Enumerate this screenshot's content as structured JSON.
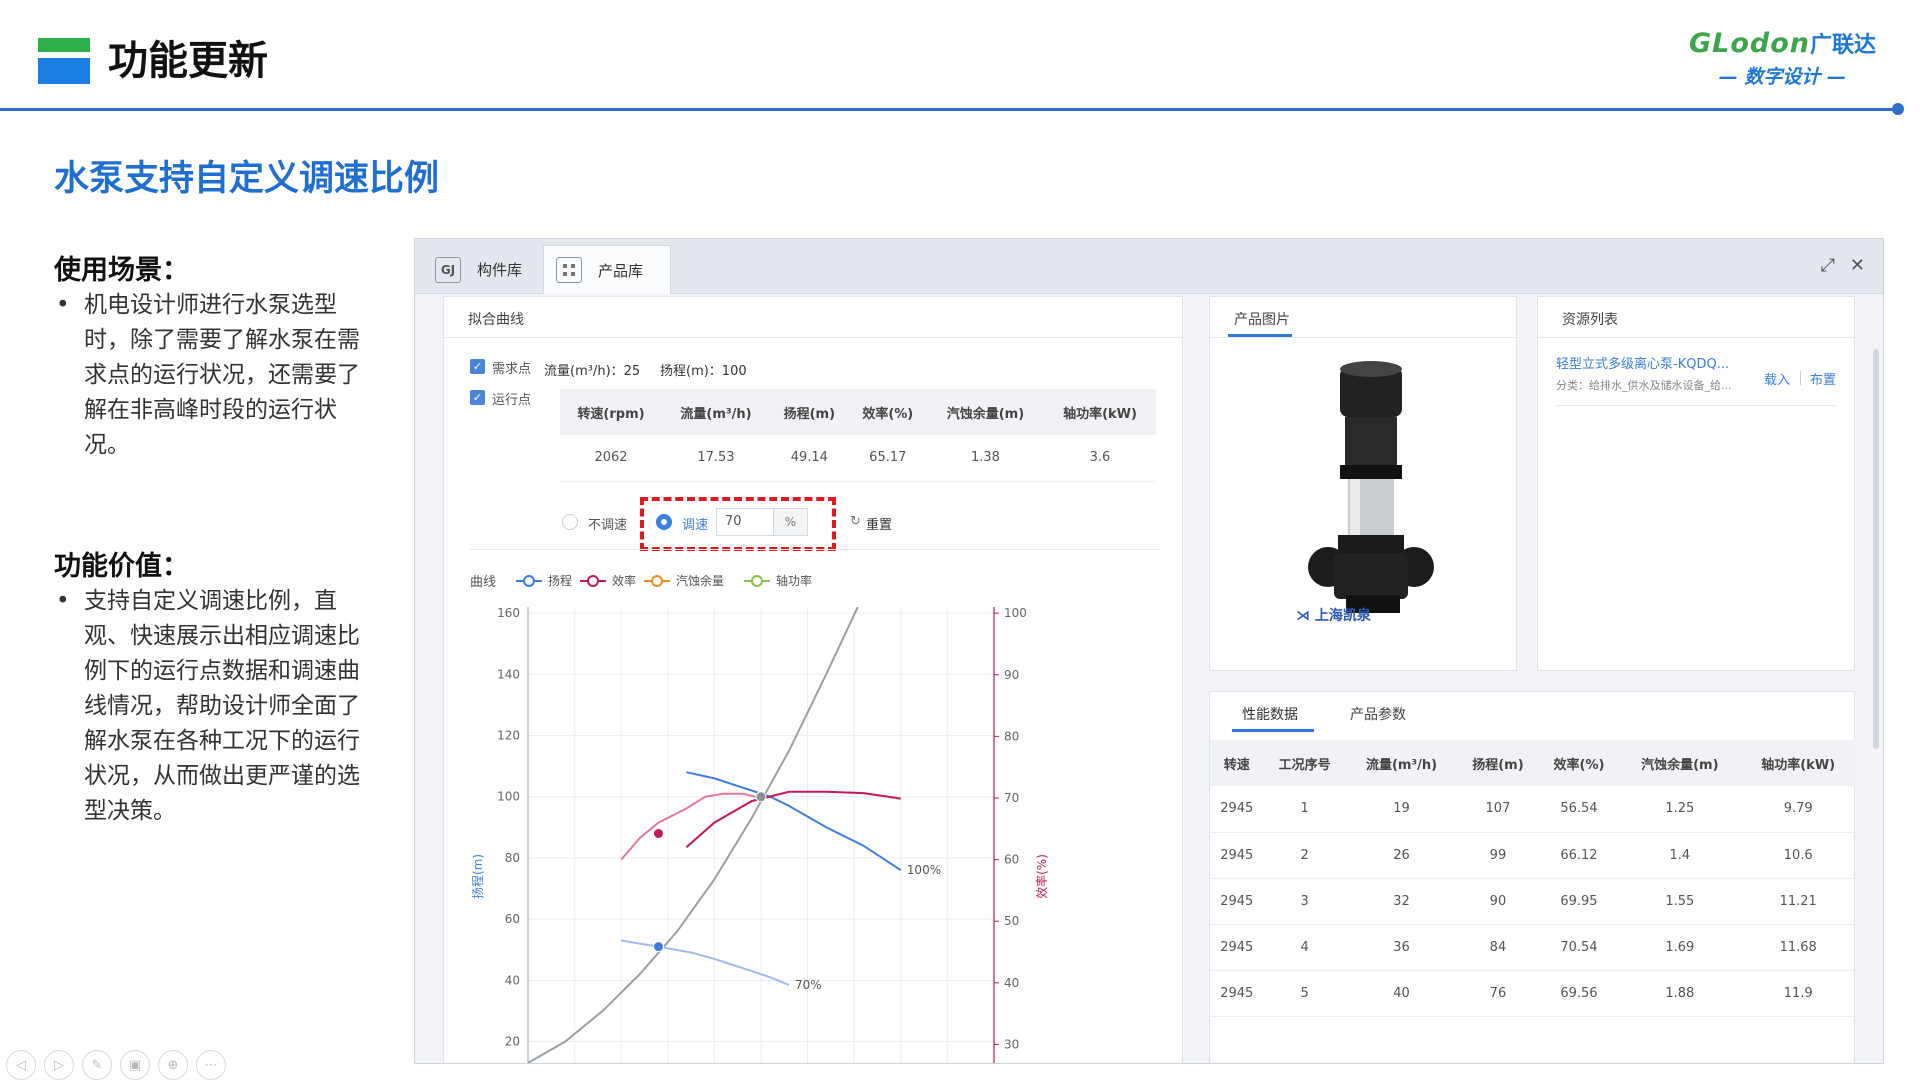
{
  "slide": {
    "title": "功能更新",
    "brand_name": "GLodon",
    "brand_cn": "广联达",
    "brand_sub": "— 数字设计 —",
    "subtitle": "水泵支持自定义调速比例",
    "scenario_heading": "使用场景：",
    "scenario_text": "机电设计师进行水泵选型时，除了需要了解水泵在需求点的运行状况，还需要了解在非高峰时段的运行状况。",
    "value_heading": "功能价值：",
    "value_text": "支持自定义调速比例，直观、快速展示出相应调速比例下的运行点数据和调速曲线情况，帮助设计师全面了解水泵在各种工况下的运行状况，从而做出更严谨的选型决策。"
  },
  "app": {
    "tabs": [
      {
        "label": "构件库",
        "icon": "GJ"
      },
      {
        "label": "产品库",
        "icon": "grid"
      }
    ],
    "curve_panel": {
      "title": "拟合曲线",
      "demand_point": {
        "checked": true,
        "label": "需求点",
        "flow_label": "流量(m³/h)：25",
        "head_label": "扬程(m)：100"
      },
      "operating_point": {
        "checked": true,
        "label": "运行点",
        "headers": [
          "转速(rpm)",
          "流量(m³/h)",
          "扬程(m)",
          "效率(%)",
          "汽蚀余量(m)",
          "轴功率(kW)"
        ],
        "values": [
          "2062",
          "17.53",
          "49.14",
          "65.17",
          "1.38",
          "3.6"
        ]
      },
      "speed": {
        "no_speed_label": "不调速",
        "speed_label": "调速",
        "speed_selected": true,
        "speed_value": "70",
        "unit": "%",
        "reset_label": "重置"
      },
      "legend_title": "曲线",
      "legend": [
        {
          "name": "扬程",
          "color": "#3f7ee0"
        },
        {
          "name": "效率",
          "color": "#c2185b"
        },
        {
          "name": "汽蚀余量",
          "color": "#f08c1c"
        },
        {
          "name": "轴功率",
          "color": "#8bc34a"
        }
      ]
    },
    "image_panel": {
      "title": "产品图片",
      "maker_logo": "上海凯泉"
    },
    "resource_panel": {
      "title": "资源列表",
      "item_name": "轻型立式多级离心泵-KQDQ...",
      "item_category": "分类：给排水_供水及储水设备_给...",
      "load_label": "载入",
      "place_label": "布置"
    },
    "perf_panel": {
      "tabs": [
        "性能数据",
        "产品参数"
      ],
      "headers": [
        "转速",
        "工况序号",
        "流量(m³/h)",
        "扬程(m)",
        "效率(%)",
        "汽蚀余量(m)",
        "轴功率(kW)"
      ],
      "rows": [
        [
          "2945",
          "1",
          "19",
          "107",
          "56.54",
          "1.25",
          "9.79"
        ],
        [
          "2945",
          "2",
          "26",
          "99",
          "66.12",
          "1.4",
          "10.6"
        ],
        [
          "2945",
          "3",
          "32",
          "90",
          "69.95",
          "1.55",
          "11.21"
        ],
        [
          "2945",
          "4",
          "36",
          "84",
          "70.54",
          "1.69",
          "11.68"
        ],
        [
          "2945",
          "5",
          "40",
          "76",
          "69.56",
          "1.88",
          "11.9"
        ]
      ]
    }
  },
  "chart_data": {
    "type": "line",
    "ylabel": "扬程(m)",
    "y2label": "效率(%)",
    "ylim": [
      12,
      162
    ],
    "y2lim": [
      26.5,
      101
    ],
    "yticks": [
      20,
      40,
      60,
      80,
      100,
      120,
      140,
      160
    ],
    "y2ticks": [
      30,
      40,
      50,
      60,
      70,
      80,
      90,
      100
    ],
    "x_range": [
      0,
      50
    ],
    "grid": true,
    "series": [
      {
        "name": "系统曲线",
        "color": "#9aa0a6",
        "axis": "left",
        "x": [
          0,
          4,
          8,
          12,
          16,
          20,
          24,
          28,
          32,
          36
        ],
        "y": [
          13,
          20,
          30,
          42,
          56,
          73,
          93,
          115,
          140,
          166
        ]
      },
      {
        "name": "扬程",
        "color": "#3f7ee0",
        "axis": "left",
        "label": "100%",
        "x": [
          17,
          20,
          24,
          26,
          28,
          32,
          36,
          40
        ],
        "y": [
          108,
          106,
          102,
          100,
          97,
          90,
          84,
          76
        ]
      },
      {
        "name": "扬程",
        "color": "#9dbdf0",
        "axis": "left",
        "label": "70%",
        "x": [
          10,
          12,
          14,
          17.5,
          20,
          22,
          24,
          26,
          28
        ],
        "y": [
          53,
          52,
          51,
          49.1,
          47,
          45,
          43,
          41,
          38.5
        ]
      },
      {
        "name": "效率",
        "color": "#c2185b",
        "axis": "right",
        "x": [
          17,
          20,
          24,
          28,
          32,
          36,
          40
        ],
        "y": [
          62,
          66,
          69.5,
          71,
          71,
          70.8,
          69.9
        ]
      },
      {
        "name": "效率",
        "color": "#e8779f",
        "axis": "right",
        "x": [
          10,
          12,
          14,
          17,
          19,
          21,
          23,
          25
        ],
        "y": [
          60,
          63.5,
          66,
          68.3,
          70.2,
          70.7,
          70.7,
          70
        ]
      }
    ],
    "points": [
      {
        "x": 25,
        "y": 100,
        "color": "#8a8f96"
      },
      {
        "x": 14,
        "y": 88,
        "color": "#c2185b"
      },
      {
        "x": 14,
        "y": 51,
        "color": "#3f7ee0"
      }
    ]
  }
}
